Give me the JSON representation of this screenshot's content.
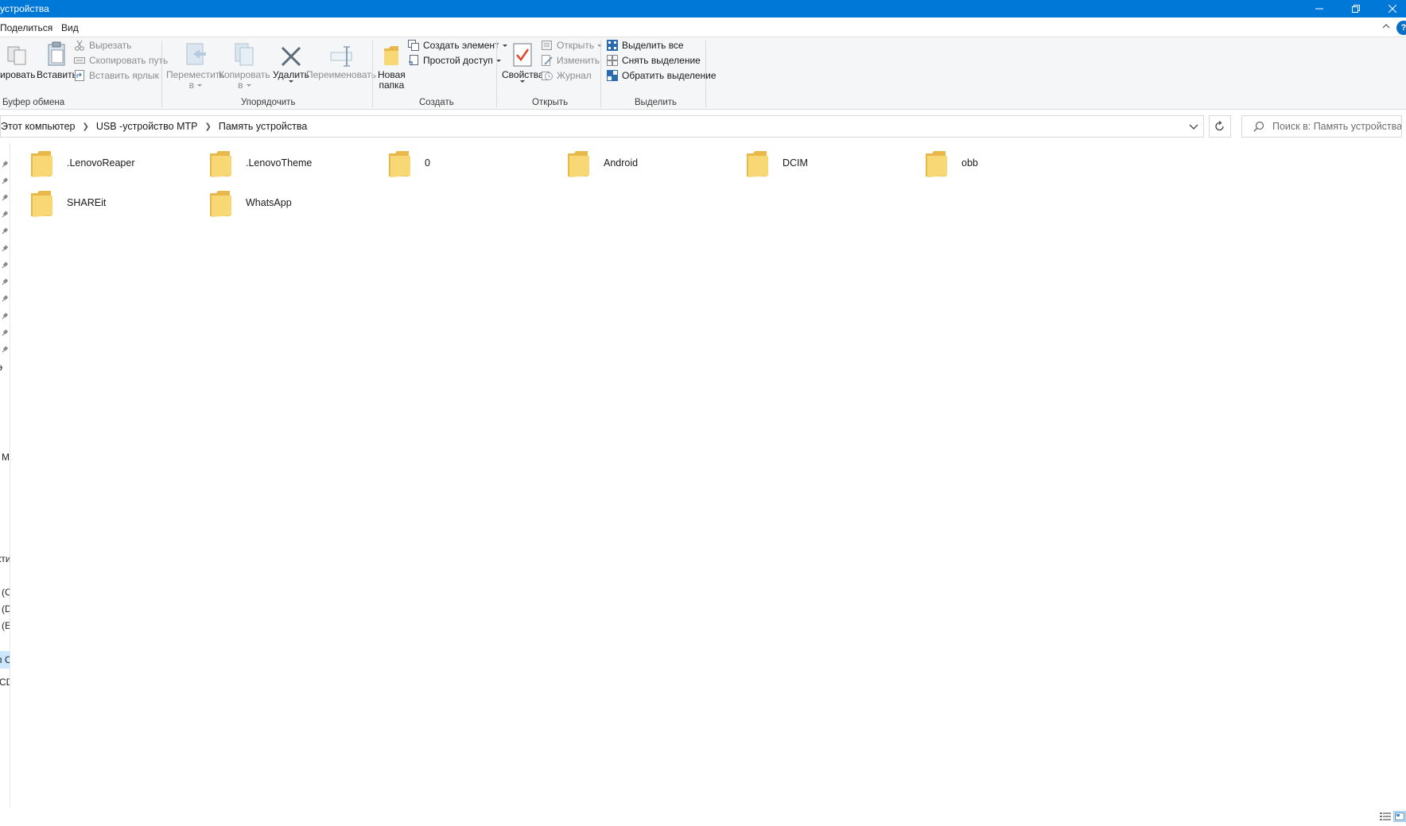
{
  "window": {
    "title": "устройства"
  },
  "tabs": [
    {
      "label": "Поделиться"
    },
    {
      "label": "Вид"
    }
  ],
  "ribbon": {
    "clipboard": {
      "copy_label": "ировать",
      "paste_label": "Вставить",
      "cut_label": "Вырезать",
      "copy_path_label": "Скопировать путь",
      "paste_shortcut_label": "Вставить ярлык",
      "group_label": "Буфер обмена"
    },
    "organize": {
      "move_label_1": "Переместить",
      "move_label_2": "в",
      "copy_to_label_1": "Копировать",
      "copy_to_label_2": "в",
      "delete_label": "Удалить",
      "rename_label": "Переименовать",
      "group_label": "Упорядочить"
    },
    "create": {
      "new_folder_label_1": "Новая",
      "new_folder_label_2": "папка",
      "new_item_label": "Создать элемент",
      "easy_access_label": "Простой доступ",
      "group_label": "Создать"
    },
    "open": {
      "properties_label": "Свойства",
      "open_label": "Открыть",
      "edit_label": "Изменить",
      "history_label": "Журнал",
      "group_label": "Открыть"
    },
    "select": {
      "select_all_label": "Выделить все",
      "select_none_label": "Снять выделение",
      "invert_label": "Обратить выделение",
      "group_label": "Выделить"
    }
  },
  "address": {
    "crumbs": [
      "Этот компьютер",
      "USB -устройство MTP",
      "Память устройства"
    ]
  },
  "search": {
    "placeholder": "Поиск в: Память устройства"
  },
  "navpane": {
    "fragments": [
      "э",
      "М",
      "кти",
      "(С",
      "(D",
      "(Е",
      "п С",
      "CD"
    ]
  },
  "folders": [
    {
      "name": ".LenovoReaper"
    },
    {
      "name": ".LenovoTheme"
    },
    {
      "name": "0"
    },
    {
      "name": "Android"
    },
    {
      "name": "DCIM"
    },
    {
      "name": "obb"
    },
    {
      "name": "SHAREit"
    },
    {
      "name": "WhatsApp"
    }
  ],
  "colors": {
    "titlebar": "#0078d7",
    "folder": "#f8d775",
    "folder_dark": "#e8b84a",
    "ribbon_bg": "#f5f6f7"
  }
}
